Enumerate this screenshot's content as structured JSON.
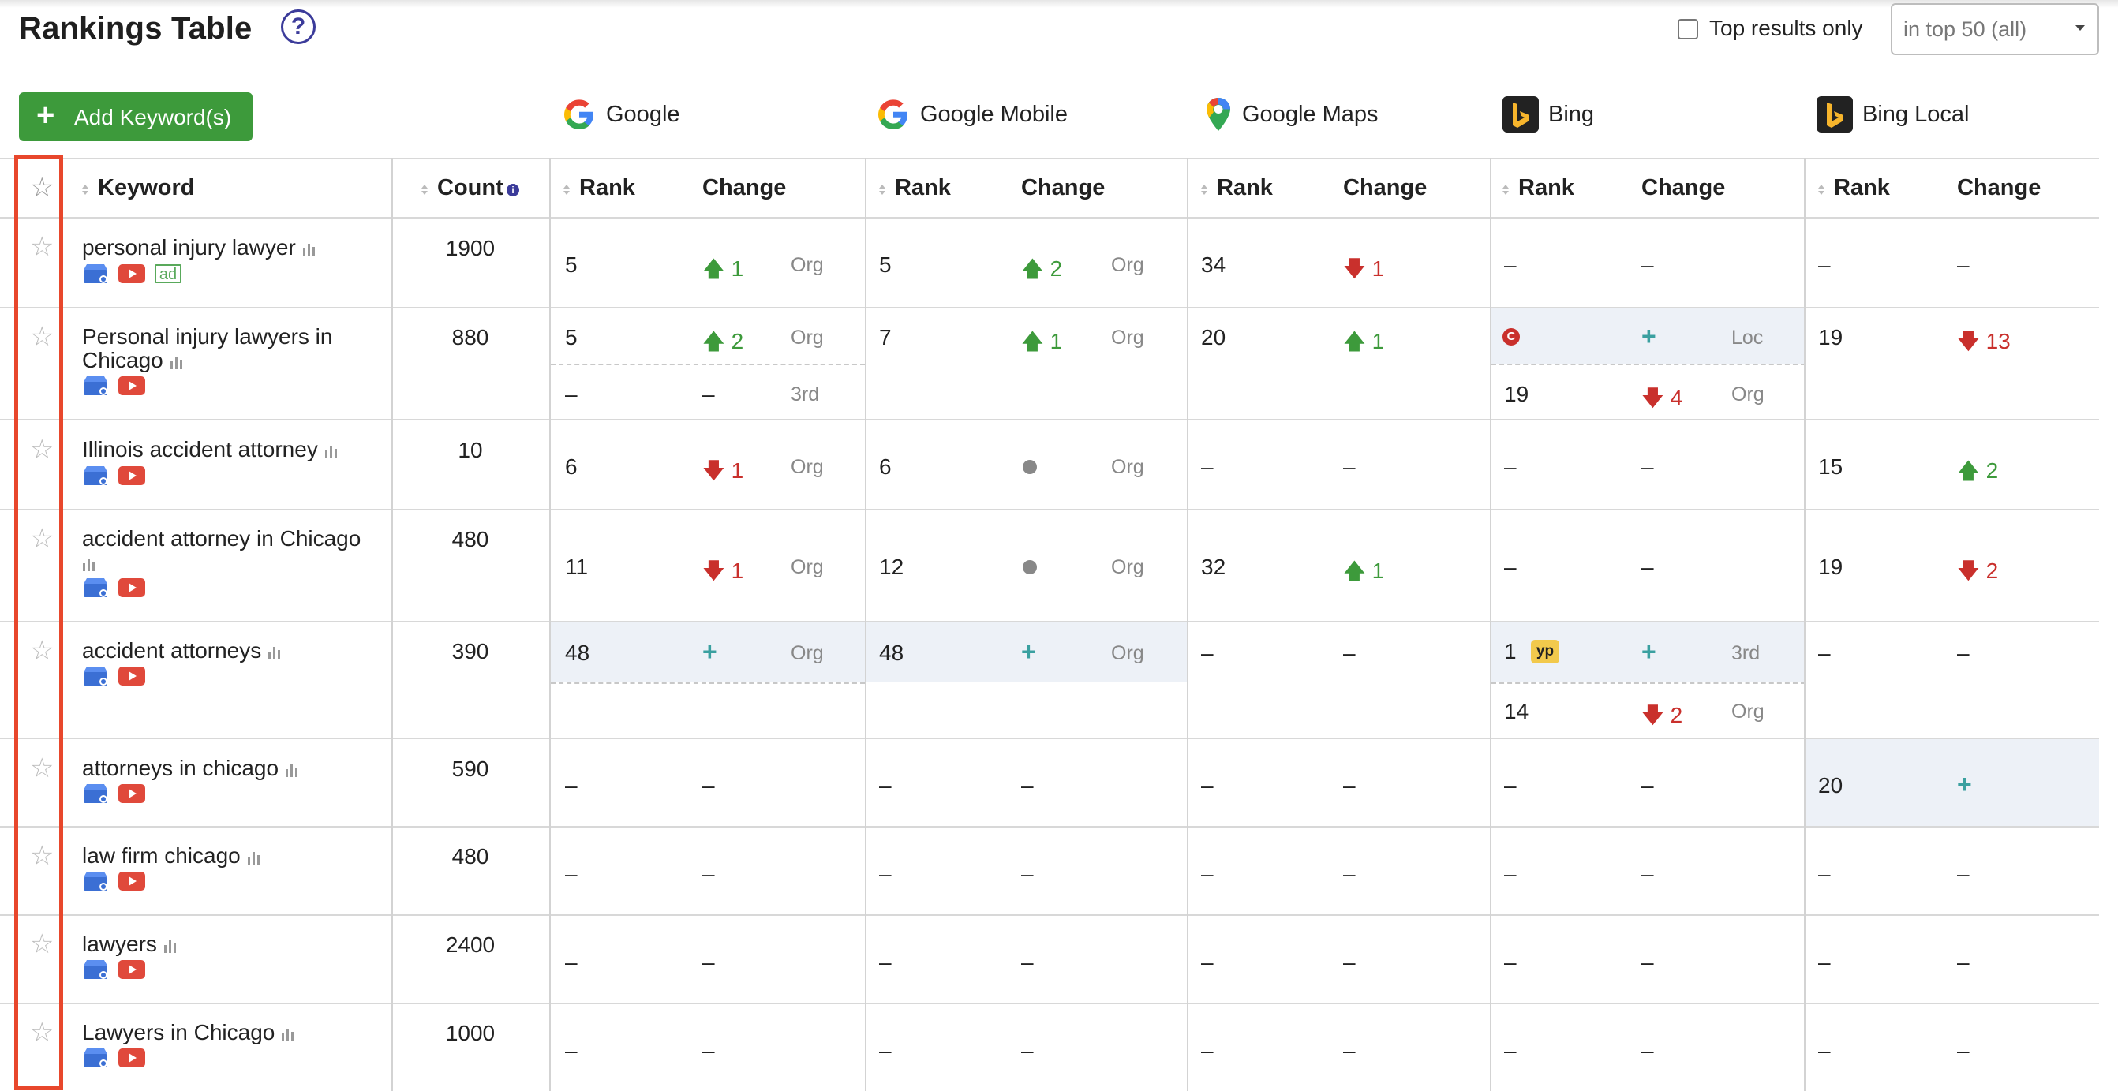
{
  "header": {
    "title": "Rankings Table",
    "help_icon": "question-circle-icon",
    "top_results_label": "Top results only",
    "top_results_checked": false,
    "filter_select_value": "in top 50 (all)"
  },
  "toolbar": {
    "add_keyword_label": "Add Keyword(s)"
  },
  "engines": [
    {
      "name": "Google",
      "icon": "google-icon"
    },
    {
      "name": "Google Mobile",
      "icon": "google-icon"
    },
    {
      "name": "Google Maps",
      "icon": "google-maps-pin-icon"
    },
    {
      "name": "Bing",
      "icon": "bing-icon"
    },
    {
      "name": "Bing Local",
      "icon": "bing-icon"
    }
  ],
  "columns": {
    "keyword": "Keyword",
    "count": "Count",
    "rank": "Rank",
    "change": "Change"
  },
  "rows": [
    {
      "keyword": "personal injury lawyer",
      "count": "1900",
      "g": {
        "rank": "5",
        "change": "1",
        "dir": "up",
        "type": "Org"
      },
      "gm": {
        "rank": "5",
        "change": "2",
        "dir": "up",
        "type": "Org"
      },
      "gmap": {
        "rank": "34",
        "change": "1",
        "dir": "down"
      },
      "bing": {
        "rank": "–",
        "change": "–"
      },
      "bl": {
        "rank": "–",
        "change": "–"
      }
    },
    {
      "keyword_line1": "Personal injury lawyers in",
      "keyword_line2": "Chicago",
      "count": "880",
      "g": {
        "rank": "5",
        "change": "2",
        "dir": "up",
        "type": "Org",
        "rank2": "–",
        "change2": "–",
        "type2": "3rd"
      },
      "gm": {
        "rank": "7",
        "change": "1",
        "dir": "up",
        "type": "Org"
      },
      "gmap": {
        "rank": "20",
        "change": "1",
        "dir": "up"
      },
      "bing": {
        "badge": "C",
        "change": "+",
        "type": "Loc",
        "rank2": "19",
        "change2": "4",
        "dir2": "down",
        "type2": "Org"
      },
      "bl": {
        "rank": "19",
        "change": "13",
        "dir": "down"
      }
    },
    {
      "keyword": "Illinois accident attorney",
      "count": "10",
      "g": {
        "rank": "6",
        "change": "1",
        "dir": "down",
        "type": "Org"
      },
      "gm": {
        "rank": "6",
        "type": "Org"
      },
      "gmap": {
        "rank": "–",
        "change": "–"
      },
      "bing": {
        "rank": "–",
        "change": "–"
      },
      "bl": {
        "rank": "15",
        "change": "2",
        "dir": "up"
      }
    },
    {
      "keyword": "accident attorney in Chicago",
      "count": "480",
      "g": {
        "rank": "11",
        "change": "1",
        "dir": "down",
        "type": "Org"
      },
      "gm": {
        "rank": "12",
        "type": "Org"
      },
      "gmap": {
        "rank": "32",
        "change": "1",
        "dir": "up"
      },
      "bing": {
        "rank": "–",
        "change": "–"
      },
      "bl": {
        "rank": "19",
        "change": "2",
        "dir": "down"
      }
    },
    {
      "keyword": "accident attorneys",
      "count": "390",
      "g": {
        "rank": "48",
        "change": "+",
        "type": "Org"
      },
      "gm": {
        "rank": "48",
        "change": "+",
        "type": "Org"
      },
      "gmap": {
        "rank": "–",
        "change": "–"
      },
      "bing": {
        "rank": "1",
        "badge": "yp",
        "change": "+",
        "type": "3rd",
        "rank2": "14",
        "change2": "2",
        "dir2": "down",
        "type2": "Org"
      },
      "bl": {
        "rank": "–",
        "change": "–"
      }
    },
    {
      "keyword": "attorneys in chicago",
      "count": "590",
      "g": {
        "rank": "–",
        "change": "–"
      },
      "gm": {
        "rank": "–",
        "change": "–"
      },
      "gmap": {
        "rank": "–",
        "change": "–"
      },
      "bing": {
        "rank": "–",
        "change": "–"
      },
      "bl": {
        "rank": "20",
        "change": "+"
      }
    },
    {
      "keyword": "law firm chicago",
      "count": "480",
      "g": {
        "rank": "–",
        "change": "–"
      },
      "gm": {
        "rank": "–",
        "change": "–"
      },
      "gmap": {
        "rank": "–",
        "change": "–"
      },
      "bing": {
        "rank": "–",
        "change": "–"
      },
      "bl": {
        "rank": "–",
        "change": "–"
      }
    },
    {
      "keyword": "lawyers",
      "count": "2400",
      "g": {
        "rank": "–",
        "change": "–"
      },
      "gm": {
        "rank": "–",
        "change": "–"
      },
      "gmap": {
        "rank": "–",
        "change": "–"
      },
      "bing": {
        "rank": "–",
        "change": "–"
      },
      "bl": {
        "rank": "–",
        "change": "–"
      }
    },
    {
      "keyword": "Lawyers in Chicago",
      "count": "1000",
      "g": {
        "rank": "–",
        "change": "–"
      },
      "gm": {
        "rank": "–",
        "change": "–"
      },
      "gmap": {
        "rank": "–",
        "change": "–"
      },
      "bing": {
        "rank": "–",
        "change": "–"
      },
      "bl": {
        "rank": "–",
        "change": "–"
      }
    }
  ],
  "colors": {
    "up": "#3d9a3b",
    "down": "#c9302c",
    "new": "#3aa0a0",
    "highlight_row": "#edf1f7",
    "annotation_box": "#e8472c",
    "add_button": "#3d9a3b"
  }
}
